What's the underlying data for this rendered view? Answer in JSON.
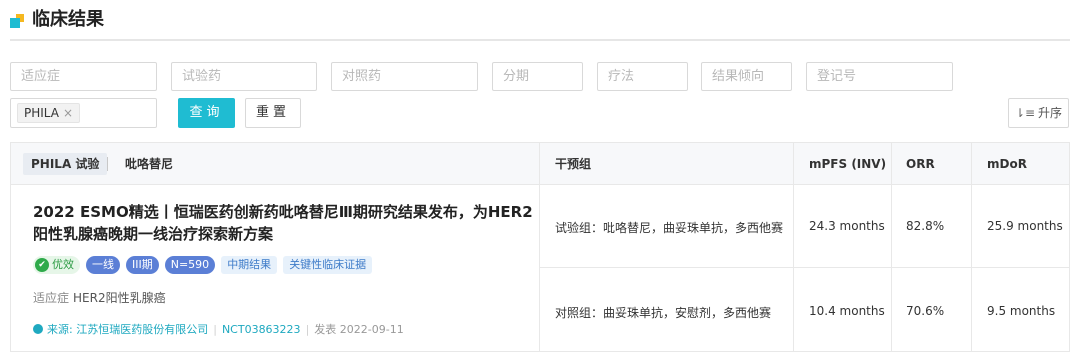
{
  "section": {
    "title": "临床结果"
  },
  "filters": {
    "indication": "适应症",
    "test_drug": "试验药",
    "control_drug": "对照药",
    "stage": "分期",
    "therapy": "疗法",
    "result_tendency": "结果倾向",
    "registration_no": "登记号"
  },
  "active_filter": {
    "chip": "PHILA",
    "remove": "×"
  },
  "buttons": {
    "query": "查询",
    "reset": "重置",
    "sort_icon": "⇂≡",
    "sort": "升序"
  },
  "table": {
    "trial_badge": "PHILA 试验",
    "drug": "吡咯替尼",
    "headers": {
      "intervention": "干预组",
      "mpfs": "mPFS (INV)",
      "orr": "ORR",
      "mdor": "mDoR"
    },
    "article": {
      "title": "2022 ESMO精选丨恒瑞医药创新药吡咯替尼Ⅲ期研究结果发布，为HER2阳性乳腺癌晚期一线治疗探索新方案",
      "tags": {
        "efficacy": "优效",
        "line": "一线",
        "phase": "III期",
        "n": "N=590",
        "interim": "中期结果",
        "pivotal": "关键性临床证据"
      },
      "indication_label": "适应症",
      "indication_value": "HER2阳性乳腺癌",
      "source_label": "来源:",
      "source_company": "江苏恒瑞医药股份有限公司",
      "nct": "NCT03863223",
      "published_label": "发表",
      "published_date": "2022-09-11"
    },
    "rows": [
      {
        "group": "试验组：吡咯替尼，曲妥珠单抗，多西他赛",
        "mpfs": "24.3 months",
        "orr": "82.8%",
        "mdor": "25.9 months"
      },
      {
        "group": "对照组：曲妥珠单抗，安慰剂，多西他赛",
        "mpfs": "10.4 months",
        "orr": "70.6%",
        "mdor": "9.5 months"
      }
    ]
  }
}
